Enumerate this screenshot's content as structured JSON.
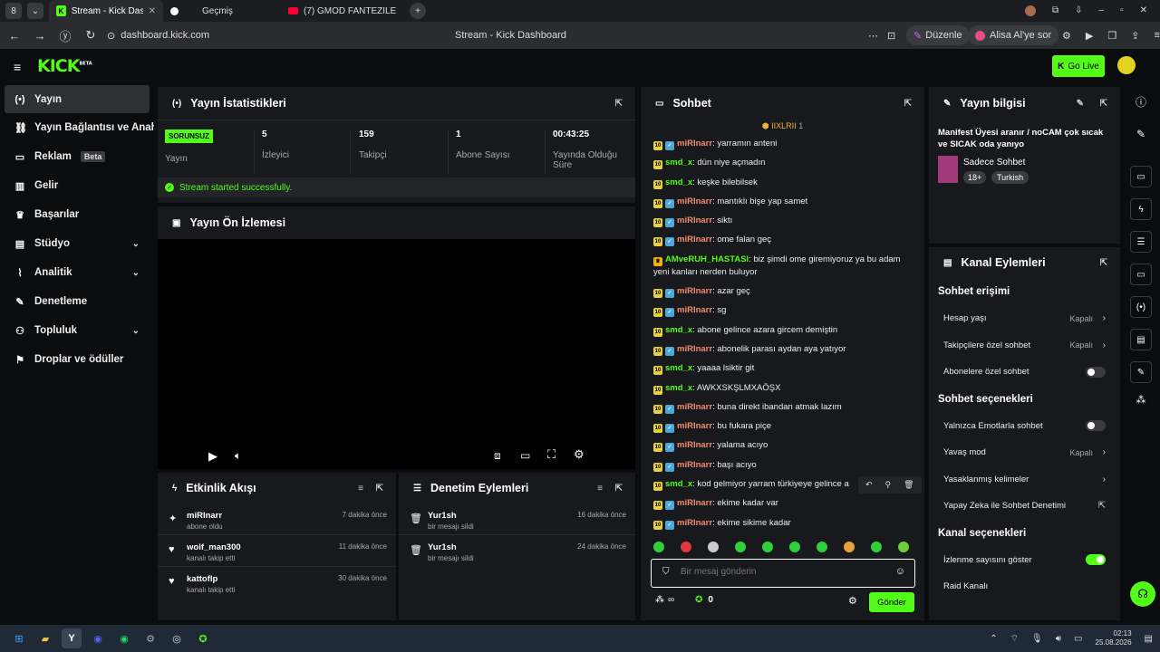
{
  "browser": {
    "tabs": [
      {
        "label": "Stream - Kick Dashboard"
      },
      {
        "label": "Geçmiş"
      },
      {
        "label": "(7) GMOD FANTEZİLERİ 2"
      }
    ],
    "url": "dashboard.kick.com",
    "page_title": "Stream - Kick Dashboard",
    "duzenle": "Düzenle",
    "alisa": "Alisa Al'ye sor"
  },
  "header": {
    "logo": "KICK",
    "logo_sup": "BETA",
    "go_live": "Go Live"
  },
  "sidebar": {
    "items": [
      {
        "label": "Yayın",
        "icon": "broadcast-icon"
      },
      {
        "label": "Yayın Bağlantısı ve Anahtarı",
        "icon": "link-icon"
      },
      {
        "label": "Reklam",
        "icon": "ad-icon",
        "badge": "Beta"
      },
      {
        "label": "Gelir",
        "icon": "chart-icon"
      },
      {
        "label": "Başarılar",
        "icon": "trophy-icon"
      },
      {
        "label": "Stüdyo",
        "icon": "studio-icon"
      },
      {
        "label": "Analitik",
        "icon": "analytics-icon"
      },
      {
        "label": "Denetleme",
        "icon": "wrench-icon"
      },
      {
        "label": "Topluluk",
        "icon": "community-icon"
      },
      {
        "label": "Droplar ve ödüller",
        "icon": "gift-icon"
      }
    ]
  },
  "stats": {
    "title": "Yayın İstatistikleri",
    "status_badge": "SORUNSUZ",
    "status_label": "Yayın",
    "viewers": "5",
    "viewers_label": "İzleyici",
    "followers": "159",
    "followers_label": "Takipçi",
    "subs": "1",
    "subs_label": "Abone Sayısı",
    "uptime": "00:43:25",
    "uptime_label": "Yayında Olduğu Süre",
    "success": "Stream started successfully."
  },
  "preview": {
    "title": "Yayın Ön İzlemesi"
  },
  "activity": {
    "title": "Etkinlik Akışı",
    "items": [
      {
        "user": "miRInarr",
        "action": "abone oldu",
        "time": "7 dakika önce"
      },
      {
        "user": "wolf_man300",
        "action": "kanalı takip etti",
        "time": "11 dakika önce"
      },
      {
        "user": "kattoflp",
        "action": "kanalı takip etti",
        "time": "30 dakika önce"
      }
    ]
  },
  "moderation": {
    "title": "Denetim Eylemleri",
    "items": [
      {
        "user": "Yur1sh",
        "action": "bir mesajı sildi",
        "time": "16 dakika önce"
      },
      {
        "user": "Yur1sh",
        "action": "bir mesajı sildi",
        "time": "24 dakika önce"
      }
    ]
  },
  "chat": {
    "title": "Sohbet",
    "pinned_user": "IIXLRII",
    "pinned_count": "1",
    "messages": [
      {
        "user": "miRInarr",
        "text": "yarramın anteni",
        "c": "n1"
      },
      {
        "user": "smd_x",
        "text": "dün niye açmadın",
        "c": "n2"
      },
      {
        "user": "smd_x",
        "text": "keşke bilebilsek",
        "c": "n2"
      },
      {
        "user": "miRInarr",
        "text": "mantıklı bişe yap samet",
        "c": "n1"
      },
      {
        "user": "miRInarr",
        "text": "siktı",
        "c": "n1"
      },
      {
        "user": "miRInarr",
        "text": "ome falan geç",
        "c": "n1"
      },
      {
        "user": "AMveRUH_HASTASI",
        "text": "biz şimdi ome giremiyoruz ya bu adam yeni kanları nerden buluyor",
        "c": "n2"
      },
      {
        "user": "miRInarr",
        "text": "azar geç",
        "c": "n1"
      },
      {
        "user": "miRInarr",
        "text": "sg",
        "c": "n1"
      },
      {
        "user": "smd_x",
        "text": "abone gelince azara gircem demiştin",
        "c": "n2"
      },
      {
        "user": "miRInarr",
        "text": "abonelik parası aydan aya yatıyor",
        "c": "n1"
      },
      {
        "user": "smd_x",
        "text": "yaaaa lsiktir git",
        "c": "n2"
      },
      {
        "user": "smd_x",
        "text": "AWKXSKŞLMXAÖŞX",
        "c": "n2"
      },
      {
        "user": "miRInarr",
        "text": "buna direkt ibandan atmak lazım",
        "c": "n1"
      },
      {
        "user": "miRInarr",
        "text": "bu fukara piçe",
        "c": "n1"
      },
      {
        "user": "miRInarr",
        "text": "yalama acıyo",
        "c": "n1"
      },
      {
        "user": "miRInarr",
        "text": "başı acıyo",
        "c": "n1"
      },
      {
        "user": "smd_x",
        "text": "kod gelmiyor yarram türkiyeye gelince a",
        "c": "n2"
      },
      {
        "user": "miRInarr",
        "text": "ekime kadar var",
        "c": "n1"
      },
      {
        "user": "miRInarr",
        "text": "ekime sikime kadar",
        "c": "n1"
      }
    ],
    "placeholder": "Bir mesaj gönderin",
    "points": "0",
    "send": "Gönder"
  },
  "info": {
    "title": "Yayın bilgisi",
    "stream_title": "Manifest Üyesi aranır / noCAM çok sıcak ve SICAK oda yanıyo",
    "category": "Sadece Sohbet",
    "tags": [
      "18+",
      "Turkish"
    ]
  },
  "channel": {
    "title": "Kanal Eylemleri",
    "chat_access": "Sohbet erişimi",
    "rows1": [
      {
        "label": "Hesap yaşı",
        "value": "Kapalı",
        "type": "arrow"
      },
      {
        "label": "Takipçilere özel sohbet",
        "value": "Kapalı",
        "type": "arrow"
      },
      {
        "label": "Abonelere özel sohbet",
        "value": "",
        "type": "toggle"
      }
    ],
    "chat_opts": "Sohbet seçenekleri",
    "rows2": [
      {
        "label": "Yalnızca Emotlarla sohbet",
        "value": "",
        "type": "toggle"
      },
      {
        "label": "Yavaş mod",
        "value": "Kapalı",
        "type": "arrow"
      },
      {
        "label": "Yasaklanmış kelimeler",
        "value": "",
        "type": "arrow"
      },
      {
        "label": "Yapay Zeka ile Sohbet Denetimi",
        "value": "",
        "type": "ext"
      }
    ],
    "channel_opts": "Kanal seçenekleri",
    "rows3": [
      {
        "label": "İzlenme sayısını göster",
        "value": "",
        "type": "toggle-on"
      },
      {
        "label": "Raid Kanalı",
        "value": "",
        "type": "none"
      }
    ]
  },
  "taskbar": {
    "time": "02:13",
    "date": "25.08.2026"
  }
}
